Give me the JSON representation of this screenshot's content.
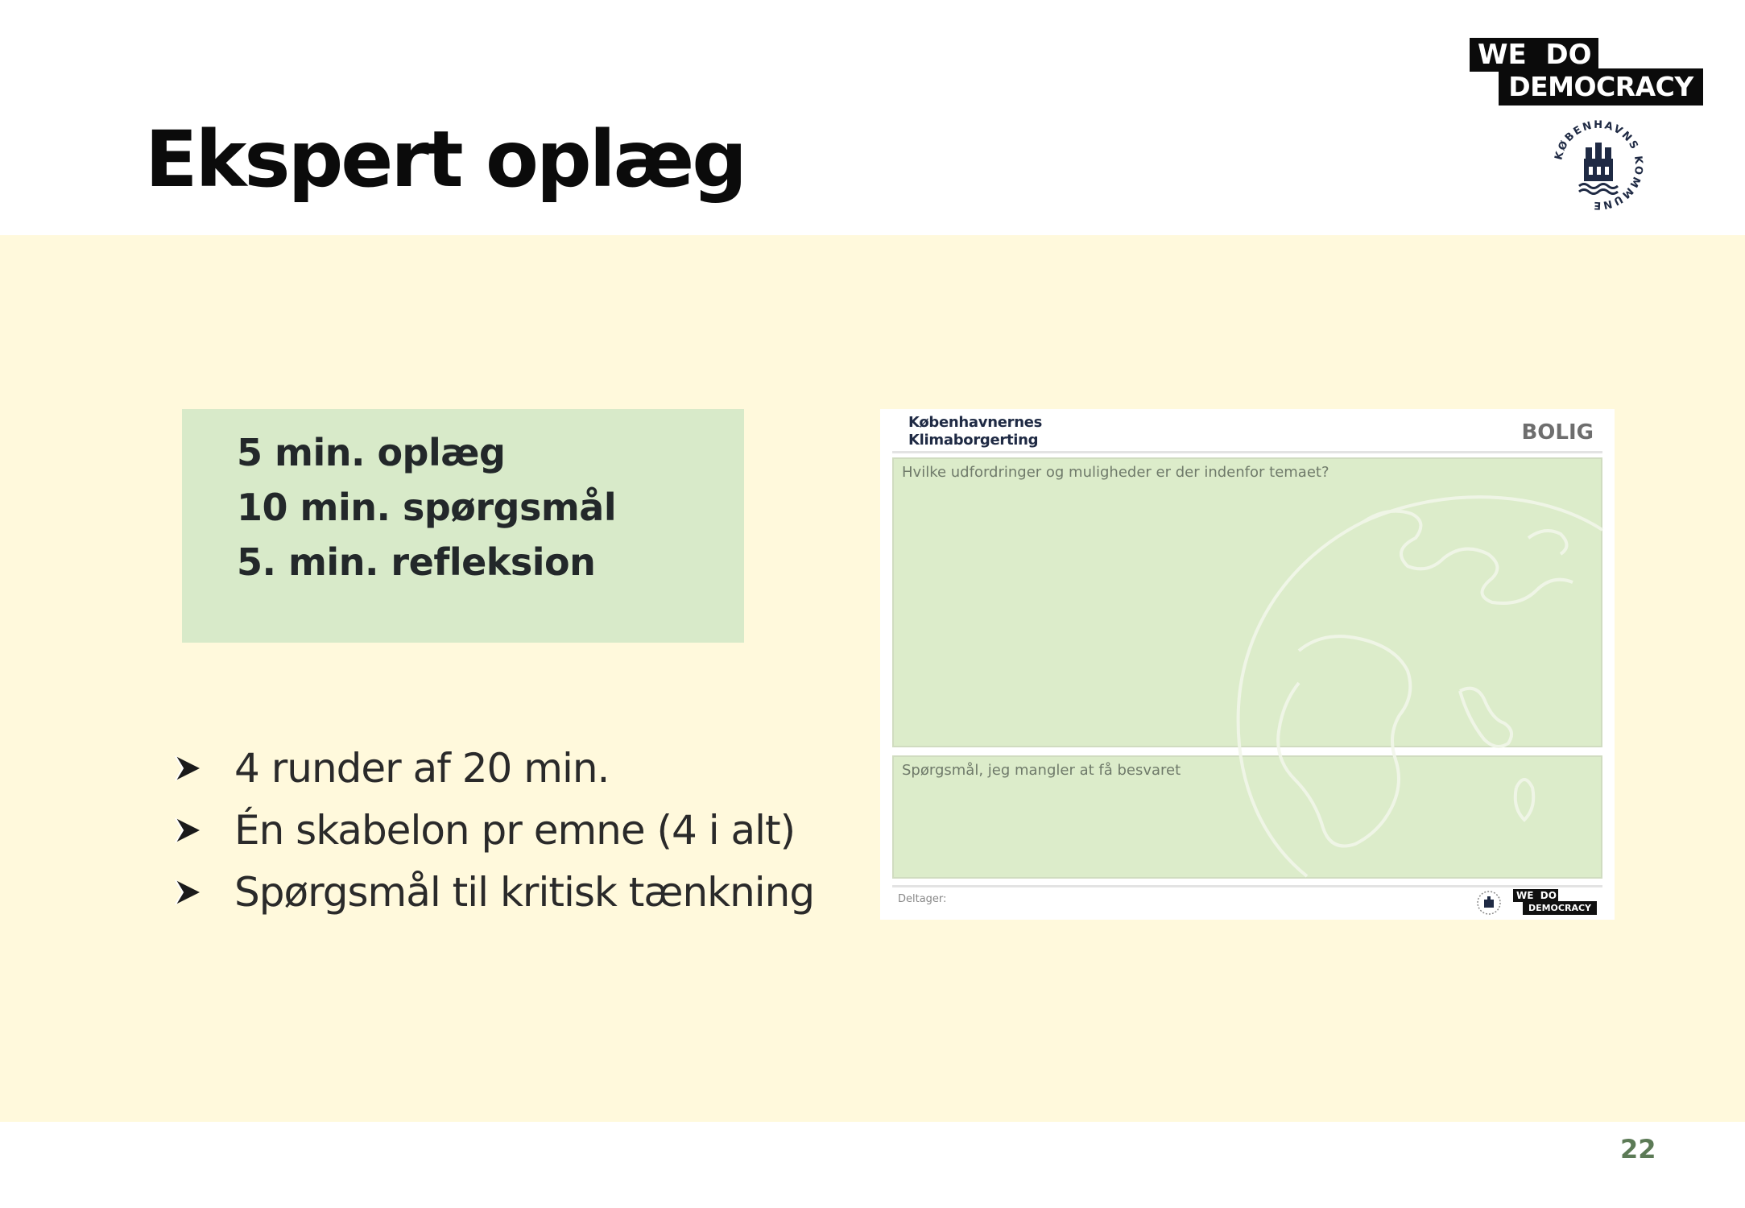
{
  "slide": {
    "title": "Ekspert oplæg",
    "page_number": "22"
  },
  "logos": {
    "wdd_line1": "WE  DO",
    "wdd_line2": "DEMOCRACY",
    "seal_text": "KØBENHAVNS KOMMUNE"
  },
  "schedule": {
    "lines": [
      "5 min. oplæg",
      "10 min. spørgsmål",
      "5. min. refleksion"
    ]
  },
  "bullets": [
    "4 runder af 20 min.",
    "Én skabelon pr emne (4 i alt)",
    "Spørgsmål til kritisk tænkning"
  ],
  "template_card": {
    "header_line1": "Københavnernes",
    "header_line2": "Klimaborgerting",
    "topic": "BOLIG",
    "question1": "Hvilke udfordringer og muligheder er der indenfor temaet?",
    "question2": "Spørgsmål, jeg mangler at få besvaret",
    "footer_label": "Deltager:",
    "footer_logo_line1": "WE  DO",
    "footer_logo_line2": "DEMOCRACY"
  },
  "colors": {
    "band_background": "#fff9dc",
    "schedule_box": "#d8eac9",
    "card_area": "#dcecca",
    "page_number": "#5c7a56"
  }
}
